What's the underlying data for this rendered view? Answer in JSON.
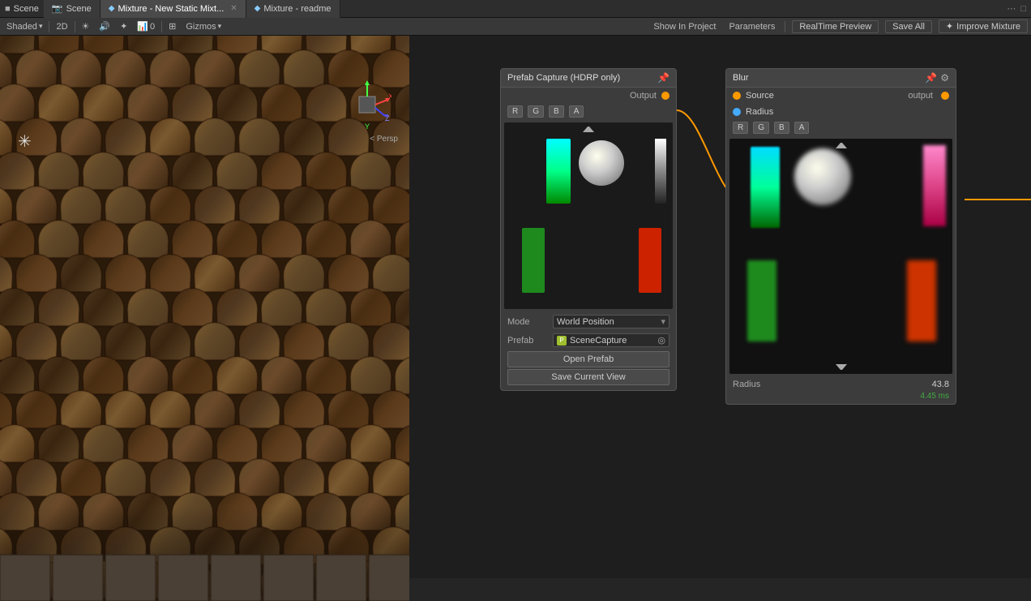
{
  "window": {
    "scene_label": "Scene",
    "tab1_label": "Mixture - New Static Mixt...",
    "tab2_label": "Mixture - readme",
    "camera_icon": "📷",
    "more_icon": "⋯"
  },
  "scene_toolbar": {
    "shaded_label": "Shaded",
    "mode_2d": "2D",
    "gizmos_label": "Gizmos",
    "persp_label": "< Persp"
  },
  "mixture_toolbar": {
    "show_in_project": "Show In Project",
    "parameters": "Parameters",
    "realtime_preview": "RealTime Preview",
    "save_all": "Save All",
    "improve_label": "Improve Mixture"
  },
  "prefab_panel": {
    "title": "Prefab Capture (HDRP only)",
    "pin_icon": "📌",
    "output_label": "Output",
    "channels": [
      "R",
      "G",
      "B",
      "A"
    ],
    "mode_label": "Mode",
    "mode_value": "World Position",
    "prefab_label": "Prefab",
    "prefab_value": "SceneCapture",
    "open_prefab_btn": "Open Prefab",
    "save_current_btn": "Save Current View"
  },
  "blur_panel": {
    "title": "Blur",
    "pin_icon": "📌",
    "settings_icon": "⚙",
    "source_label": "Source",
    "output_label": "output",
    "radius_label": "Radius",
    "channels": [
      "R",
      "G",
      "B",
      "A"
    ],
    "radius_value": "43.8",
    "radius_timing": "4.45 ms"
  }
}
